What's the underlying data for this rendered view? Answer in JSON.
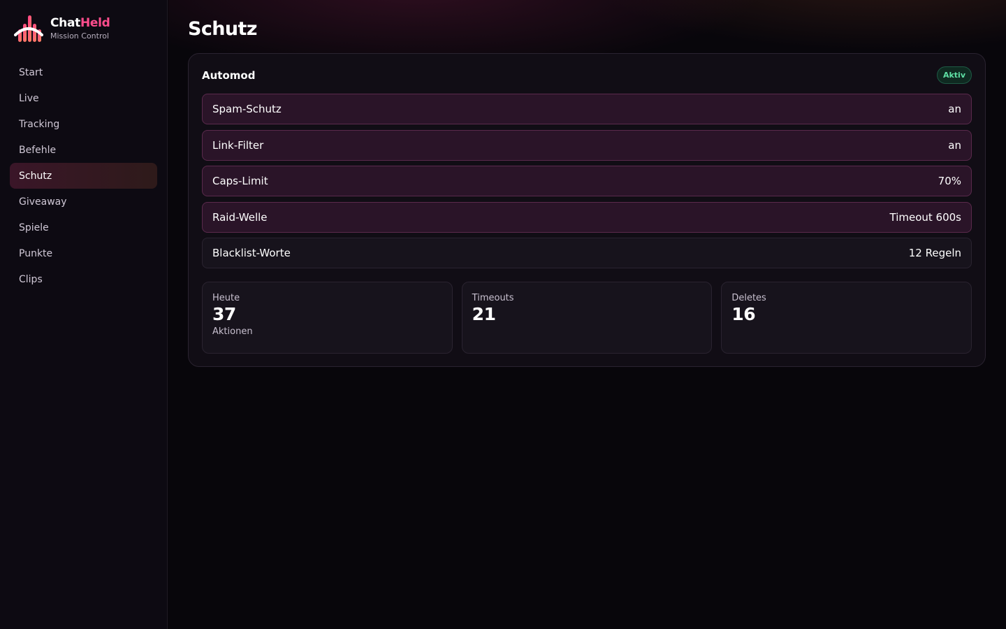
{
  "brand": {
    "name_a": "Chat",
    "name_b": "Held",
    "subtitle": "Mission Control"
  },
  "nav": [
    {
      "label": "Start"
    },
    {
      "label": "Live"
    },
    {
      "label": "Tracking"
    },
    {
      "label": "Befehle"
    },
    {
      "label": "Schutz",
      "active": true
    },
    {
      "label": "Giveaway"
    },
    {
      "label": "Spiele"
    },
    {
      "label": "Punkte"
    },
    {
      "label": "Clips"
    }
  ],
  "page": {
    "title": "Schutz"
  },
  "automod": {
    "title": "Automod",
    "status": "Aktiv",
    "rules": [
      {
        "label": "Spam-Schutz",
        "value": "an"
      },
      {
        "label": "Link-Filter",
        "value": "an"
      },
      {
        "label": "Caps-Limit",
        "value": "70%"
      },
      {
        "label": "Raid-Welle",
        "value": "Timeout 600s"
      },
      {
        "label": "Blacklist-Worte",
        "value": "12 Regeln"
      }
    ]
  },
  "stats": [
    {
      "label": "Heute",
      "value": "37",
      "sub": "Aktionen"
    },
    {
      "label": "Timeouts",
      "value": "21",
      "sub": ""
    },
    {
      "label": "Deletes",
      "value": "16",
      "sub": ""
    }
  ],
  "colors": {
    "accent_pink": "#ff4d8d",
    "status_green": "#5fe0a5",
    "active_row_bg": "#2a1428",
    "active_row_border": "#5a2a4c"
  }
}
